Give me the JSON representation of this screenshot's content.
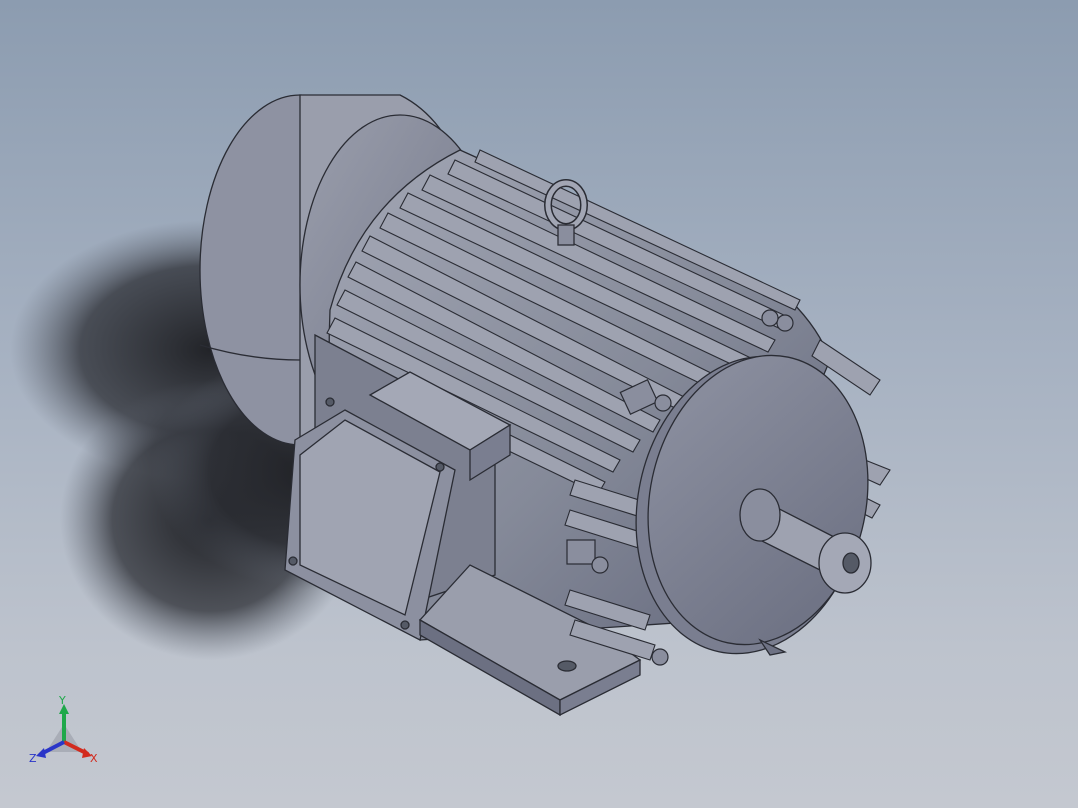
{
  "viewport": {
    "background_top": "#8c9cb0",
    "background_bottom": "#c4c8d0"
  },
  "model": {
    "body_color": "#8a8e9e",
    "shadow_color": "#202226"
  },
  "triad": {
    "x_label": "X",
    "y_label": "Y",
    "z_label": "Z",
    "x_color": "#d22a1e",
    "y_color": "#1fa84a",
    "z_color": "#2a35c8"
  }
}
